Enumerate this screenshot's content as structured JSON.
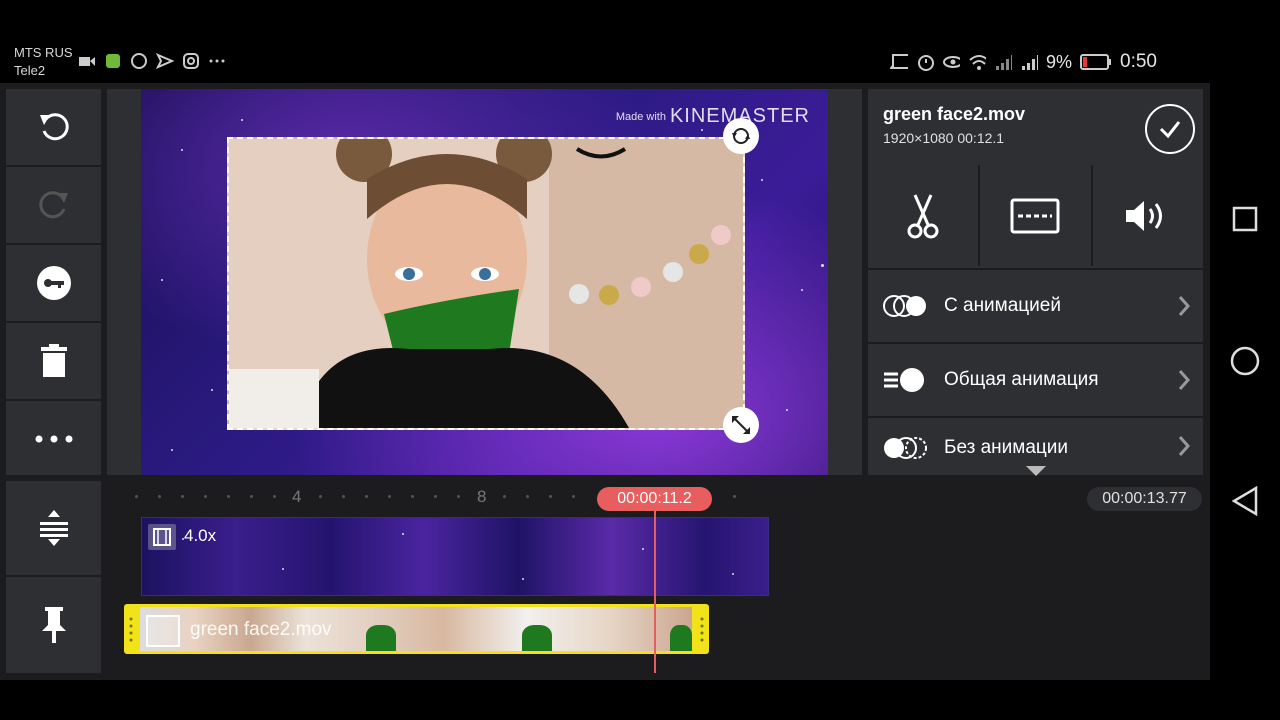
{
  "status_bar": {
    "carrier1": "MTS RUS",
    "carrier2": "Tele2",
    "battery": "9%",
    "time": "0:50",
    "icons_left": [
      "video-icon",
      "app-icon",
      "whatsapp-icon",
      "send-icon",
      "instagram-icon",
      "more-icon"
    ],
    "icons_right": [
      "cast-icon",
      "alarm-icon",
      "eye-icon",
      "wifi-icon",
      "signal1-icon",
      "signal2-icon",
      "battery-icon"
    ]
  },
  "left_toolbar": {
    "items": [
      {
        "name": "undo-button",
        "icon": "undo-icon",
        "enabled": true
      },
      {
        "name": "redo-button",
        "icon": "redo-icon",
        "enabled": false
      },
      {
        "name": "keyframe-button",
        "icon": "key-icon",
        "enabled": true
      },
      {
        "name": "delete-button",
        "icon": "trash-icon",
        "enabled": true
      },
      {
        "name": "more-button",
        "icon": "more-icon",
        "enabled": true
      }
    ],
    "bottom_items": [
      {
        "name": "timeline-expand-button",
        "icon": "expand-icon"
      },
      {
        "name": "pin-button",
        "icon": "pin-icon"
      }
    ]
  },
  "preview": {
    "watermark_small": "Made with",
    "watermark_big": "KINEMASTER"
  },
  "inspector": {
    "clip_name": "green face2.mov",
    "clip_meta": "1920×1080  00:12.1",
    "tools": [
      "scissors-icon",
      "split-screen-icon",
      "volume-icon"
    ],
    "menu": [
      {
        "label": "С анимацией",
        "icon": "anim-in-icon"
      },
      {
        "label": "Общая анимация",
        "icon": "anim-overall-icon"
      },
      {
        "label": "Без анимации",
        "icon": "anim-out-icon"
      }
    ]
  },
  "timeline": {
    "ruler_marks": [
      "4",
      "8"
    ],
    "playhead_time": "00:00:11.2",
    "total_time": "00:00:13.77",
    "track1_speed": "4.0x",
    "track2_label": "green face2.mov"
  },
  "colors": {
    "accent": "#e85d5d",
    "selection": "#f2e21a",
    "panel": "#2e2f33",
    "background": "#1c1c1e"
  }
}
